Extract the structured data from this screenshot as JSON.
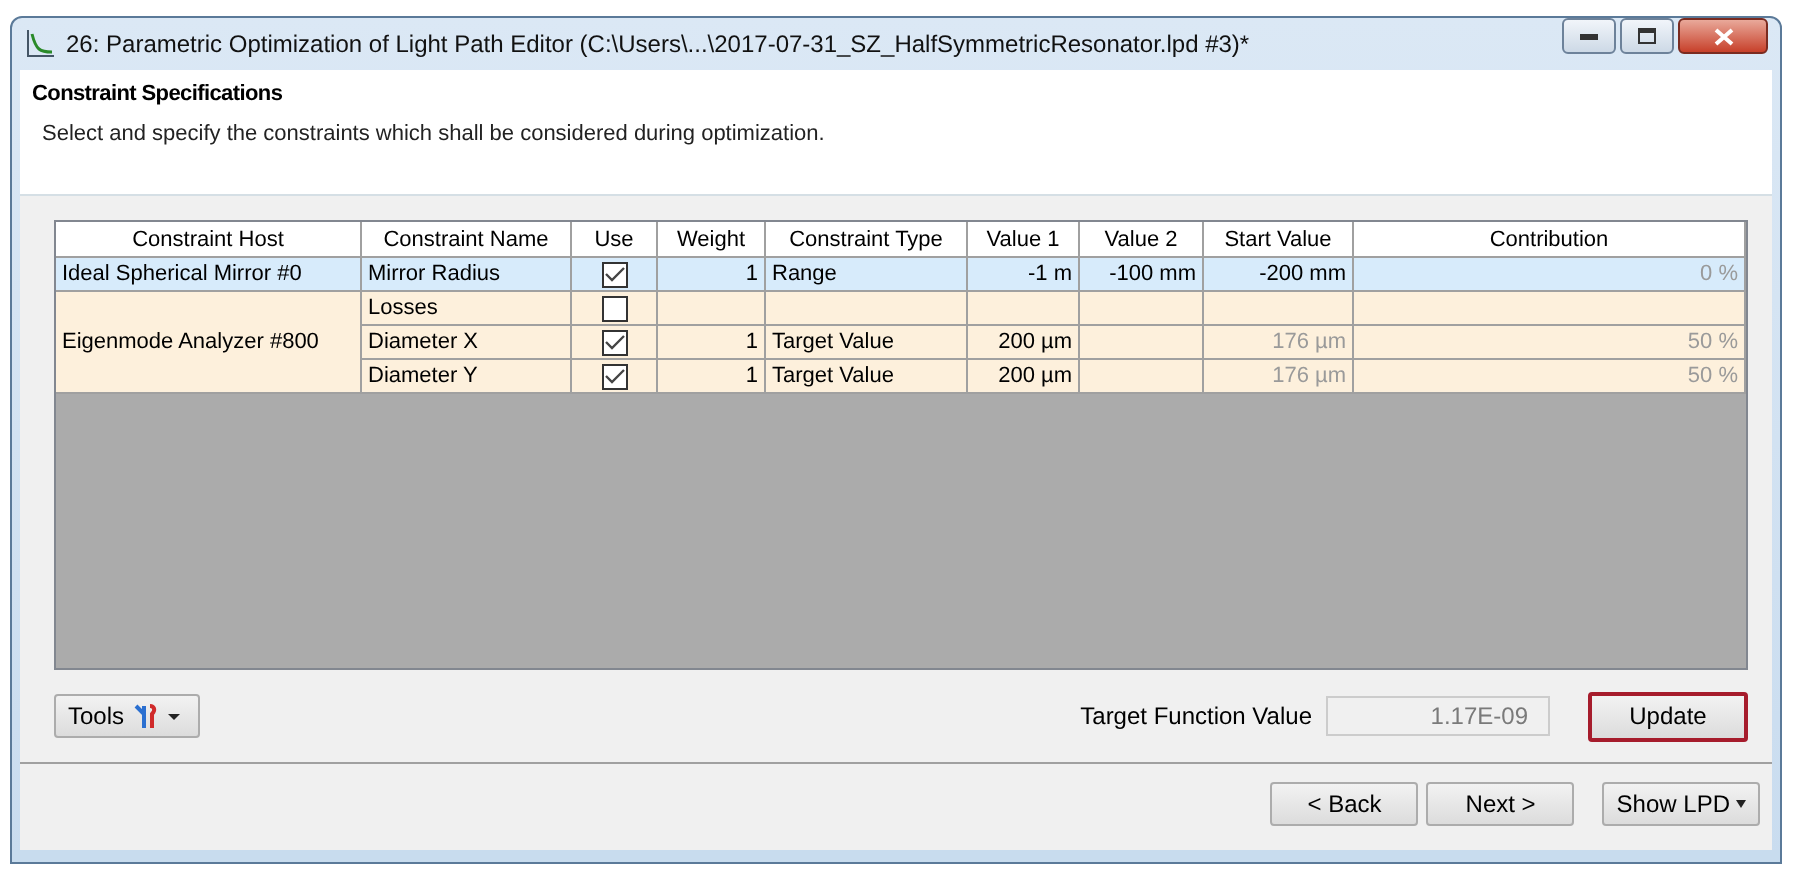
{
  "window": {
    "title": "26: Parametric Optimization of Light Path Editor (C:\\Users\\...\\2017-07-31_SZ_HalfSymmetricResonator.lpd #3)*"
  },
  "header": {
    "title": "Constraint Specifications",
    "description": "Select and specify the constraints which shall be considered during optimization."
  },
  "table": {
    "columns": [
      "Constraint Host",
      "Constraint Name",
      "Use",
      "Weight",
      "Constraint Type",
      "Value 1",
      "Value 2",
      "Start Value",
      "Contribution"
    ],
    "groups": [
      {
        "host": "Ideal Spherical Mirror #0",
        "selected": true,
        "constraints": [
          {
            "name": "Mirror Radius",
            "use": true,
            "weight": "1",
            "type": "Range",
            "value_1": "-1 m",
            "value_2": "-100 mm",
            "start_value": "-200 mm",
            "start_value_disabled": false,
            "contribution": "0 %"
          }
        ]
      },
      {
        "host": "Eigenmode Analyzer #800",
        "selected": false,
        "constraints": [
          {
            "name": "Losses",
            "use": false
          },
          {
            "name": "Diameter X",
            "use": true,
            "weight": "1",
            "type": "Target Value",
            "value_1": "200 µm",
            "start_value": "176 µm",
            "start_value_disabled": true,
            "contribution": "50 %"
          },
          {
            "name": "Diameter Y",
            "use": true,
            "weight": "1",
            "type": "Target Value",
            "value_1": "200 µm",
            "start_value": "176 µm",
            "start_value_disabled": true,
            "contribution": "50 %"
          }
        ]
      }
    ]
  },
  "tools_button": {
    "label": "Tools"
  },
  "target_function": {
    "label": "Target Function Value",
    "value": "1.17E-09"
  },
  "update_button": {
    "label": "Update",
    "highlighted": true
  },
  "nav_buttons": [
    {
      "label": "< Back"
    },
    {
      "label": "Next >"
    }
  ],
  "show_button": {
    "label": "Show  LPD"
  }
}
